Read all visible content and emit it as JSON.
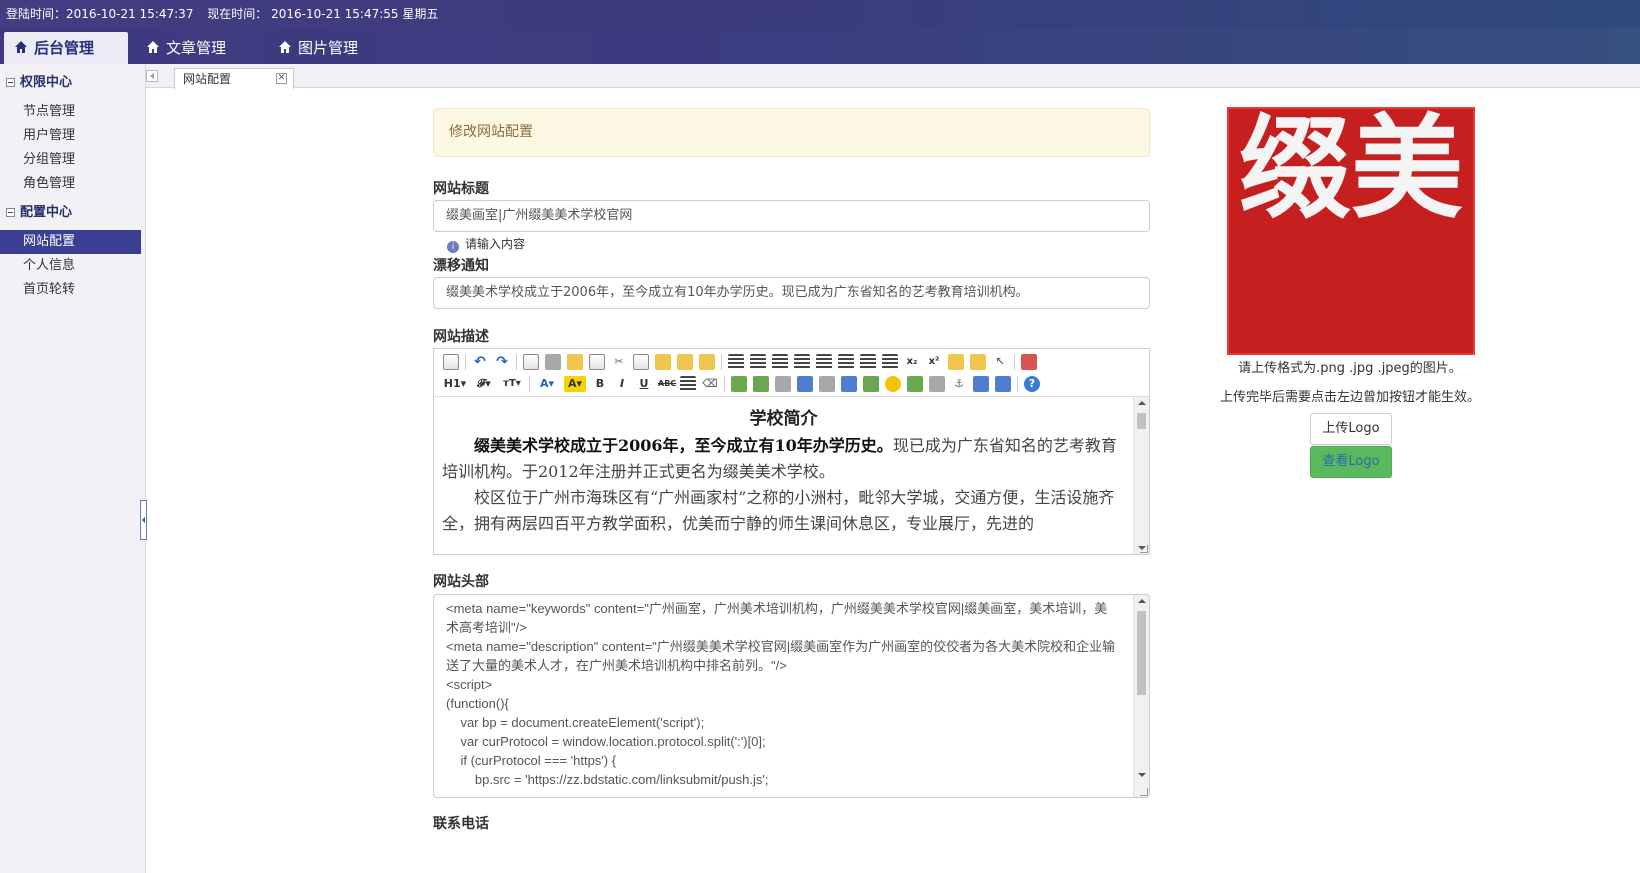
{
  "topbar": {
    "login_time": "登陆时间：2016-10-21 15:47:37",
    "now_time": "现在时间： 2016-10-21 15:47:55 星期五"
  },
  "nav": {
    "tabs": [
      {
        "label": "后台管理",
        "icon": "home-icon",
        "active": true
      },
      {
        "label": "文章管理",
        "icon": "home-icon",
        "active": false
      },
      {
        "label": "图片管理",
        "icon": "home-icon",
        "active": false
      }
    ]
  },
  "sidebar": {
    "groups": [
      {
        "title": "权限中心",
        "items": [
          "节点管理",
          "用户管理",
          "分组管理",
          "角色管理"
        ]
      },
      {
        "title": "配置中心",
        "items": [
          "网站配置",
          "个人信息",
          "首页轮转"
        ]
      }
    ],
    "active_item": "网站配置"
  },
  "tabs": {
    "current": "网站配置"
  },
  "form": {
    "notice": "修改网站配置",
    "site_title_label": "网站标题",
    "site_title_value": "缀美画室|广州缀美美术学校官网",
    "site_title_hint": "请输入内容",
    "drift_label": "漂移通知",
    "drift_value": "缀美美术学校成立于2006年，至今成立有10年办学历史。现已成为广东省知名的艺考教育培训机构。",
    "desc_label": "网站描述",
    "editor": {
      "heading": "学校简介",
      "p1_bold": "缀美美术学校成立于2006年，至今成立有10年办学历史。",
      "p1_rest": "现已成为广东省知名的艺考教育培训机构。于2012年注册并正式更名为缀美美术学校。",
      "p2": "校区位于广州市海珠区有“广州画家村”之称的小洲村，毗邻大学城，交通方便，生活设施齐全，拥有两层四百平方教学面积，优美而宁静的师生课间休息区，专业展厅，先进的"
    },
    "head_label": "网站头部",
    "head_code": "<meta name=\"keywords\" content=\"广州画室，广州美术培训机构，广州缀美美术学校官网|缀美画室，美术培训，美术高考培训\"/>\n<meta name=\"description\" content=\"广州缀美美术学校官网|缀美画室作为广州画室的佼佼者为各大美术院校和企业输送了大量的美术人才，在广州美术培训机构中排名前列。\"/>\n<script>\n(function(){\n    var bp = document.createElement('script');\n    var curProtocol = window.location.protocol.split(':')[0];\n    if (curProtocol === 'https') {\n        bp.src = 'https://zz.bdstatic.com/linksubmit/push.js';",
    "phone_label": "联系电话"
  },
  "logo_panel": {
    "seal_chars": "缀美",
    "note1": "请上传格式为.png .jpg .jpeg的图片。",
    "note2": "上传完毕后需要点击左边曾加按钮才能生效。",
    "upload_button": "上传Logo",
    "view_button": "查看Logo"
  }
}
